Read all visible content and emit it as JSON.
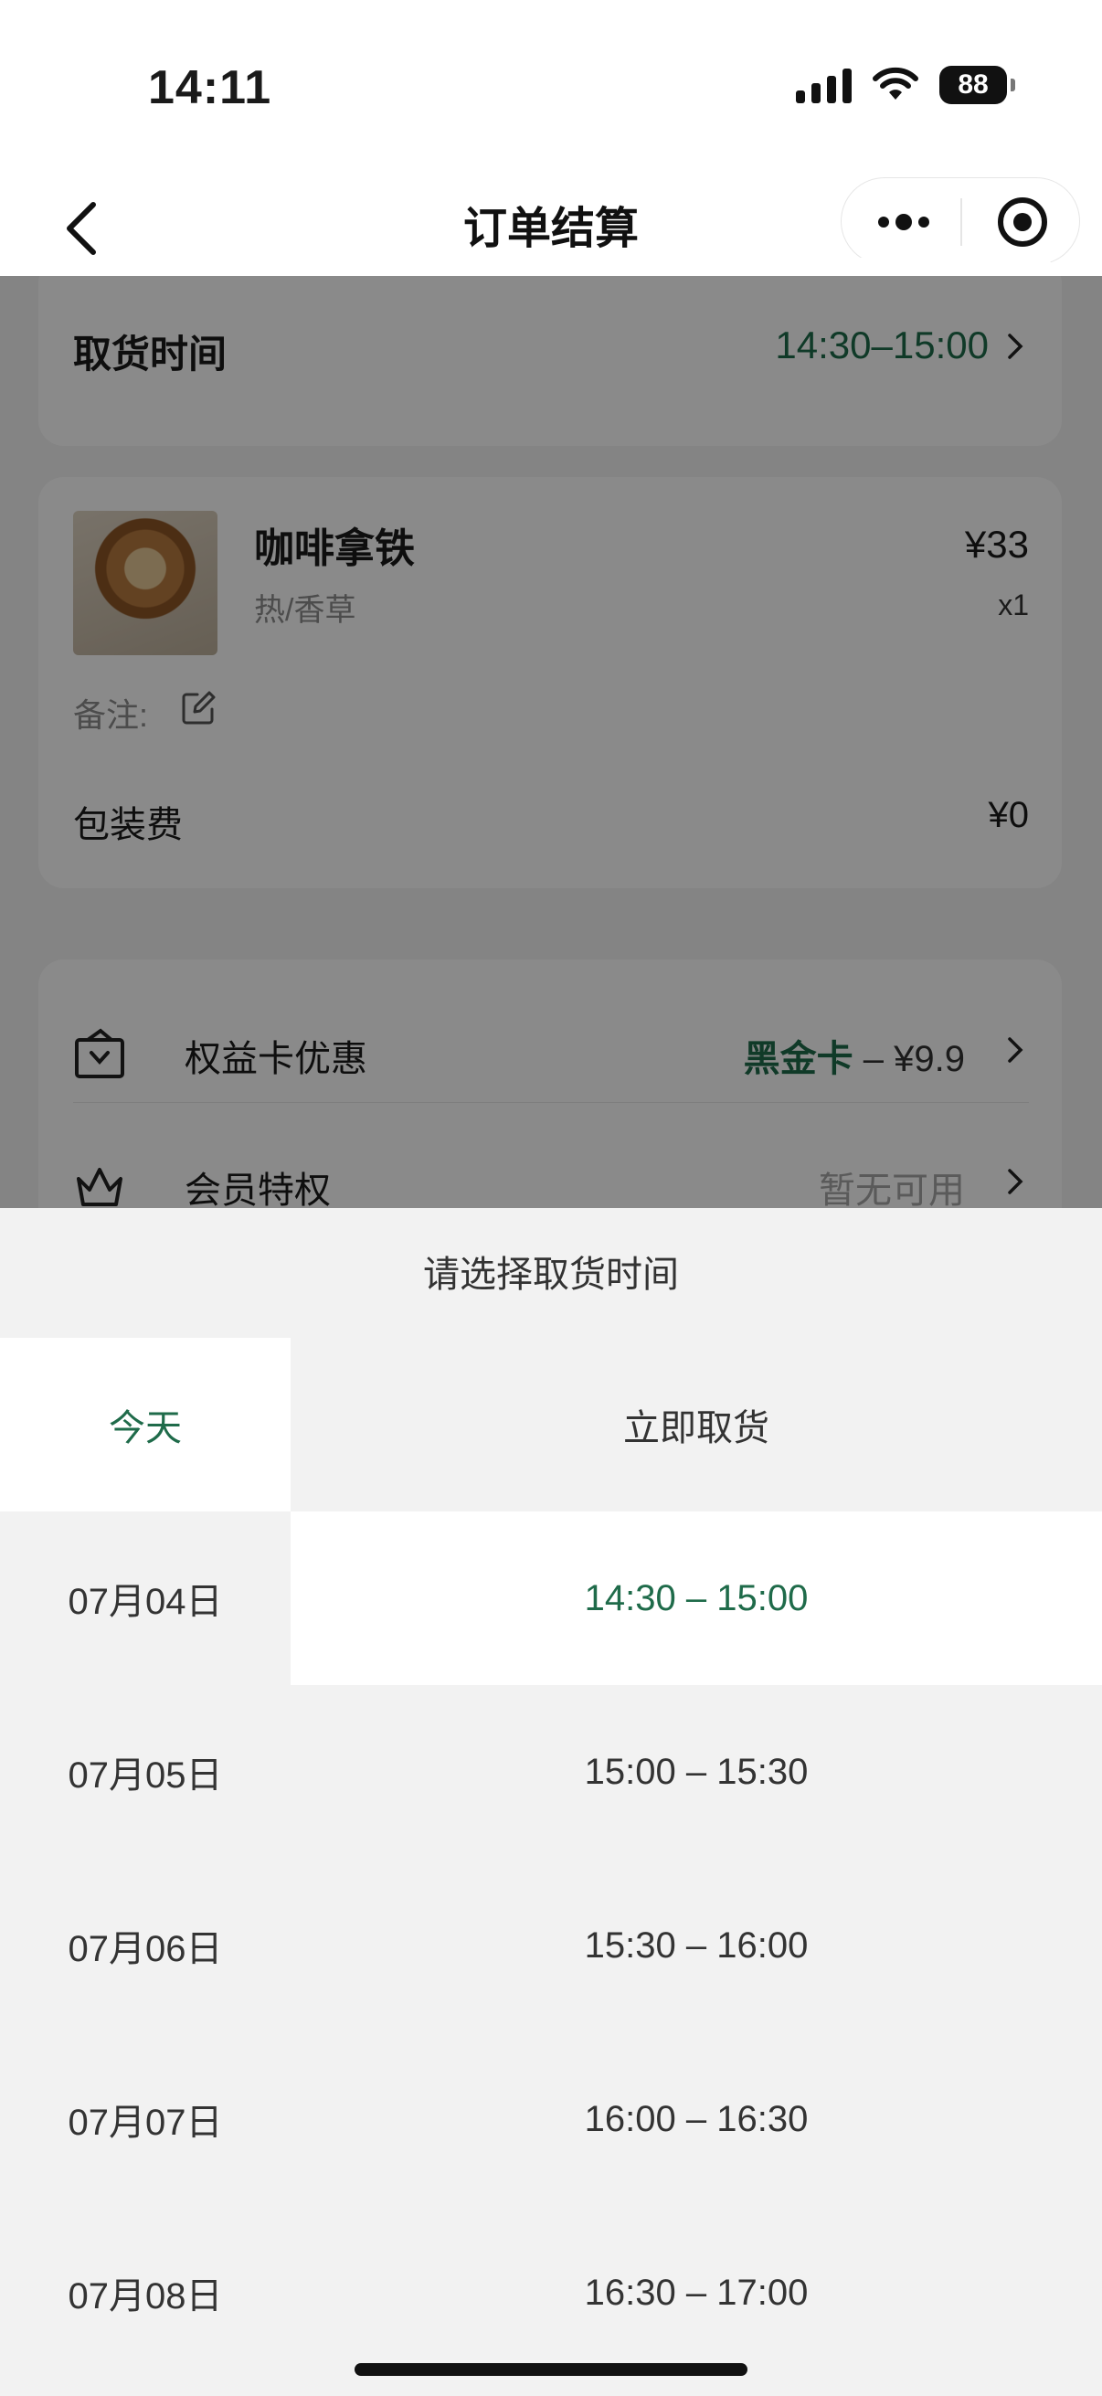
{
  "status_bar": {
    "time": "14:11",
    "battery": "88"
  },
  "nav": {
    "title": "订单结算"
  },
  "pickup": {
    "label": "取货时间",
    "value": "14:30–15:00"
  },
  "product": {
    "name": "咖啡拿铁",
    "spec": "热/香草",
    "price": "¥33",
    "qty": "x1",
    "remark_label": "备注:",
    "packaging_label": "包装费",
    "packaging_value": "¥0"
  },
  "benefits": {
    "card_label": "权益卡优惠",
    "card_brand": "黑金卡",
    "card_discount": " – ¥9.9",
    "member_label": "会员特权",
    "member_value": "暂无可用"
  },
  "sheet": {
    "title": "请选择取货时间",
    "days": [
      "今天",
      "07月04日",
      "07月05日",
      "07月06日",
      "07月07日",
      "07月08日"
    ],
    "slots": [
      "立即取货",
      "14:30 – 15:00",
      "15:00 – 15:30",
      "15:30 – 16:00",
      "16:00 – 16:30",
      "16:30 – 17:00"
    ]
  },
  "colors": {
    "brand_green": "#1f6b4a",
    "sheet_bg": "#f2f2f2"
  }
}
